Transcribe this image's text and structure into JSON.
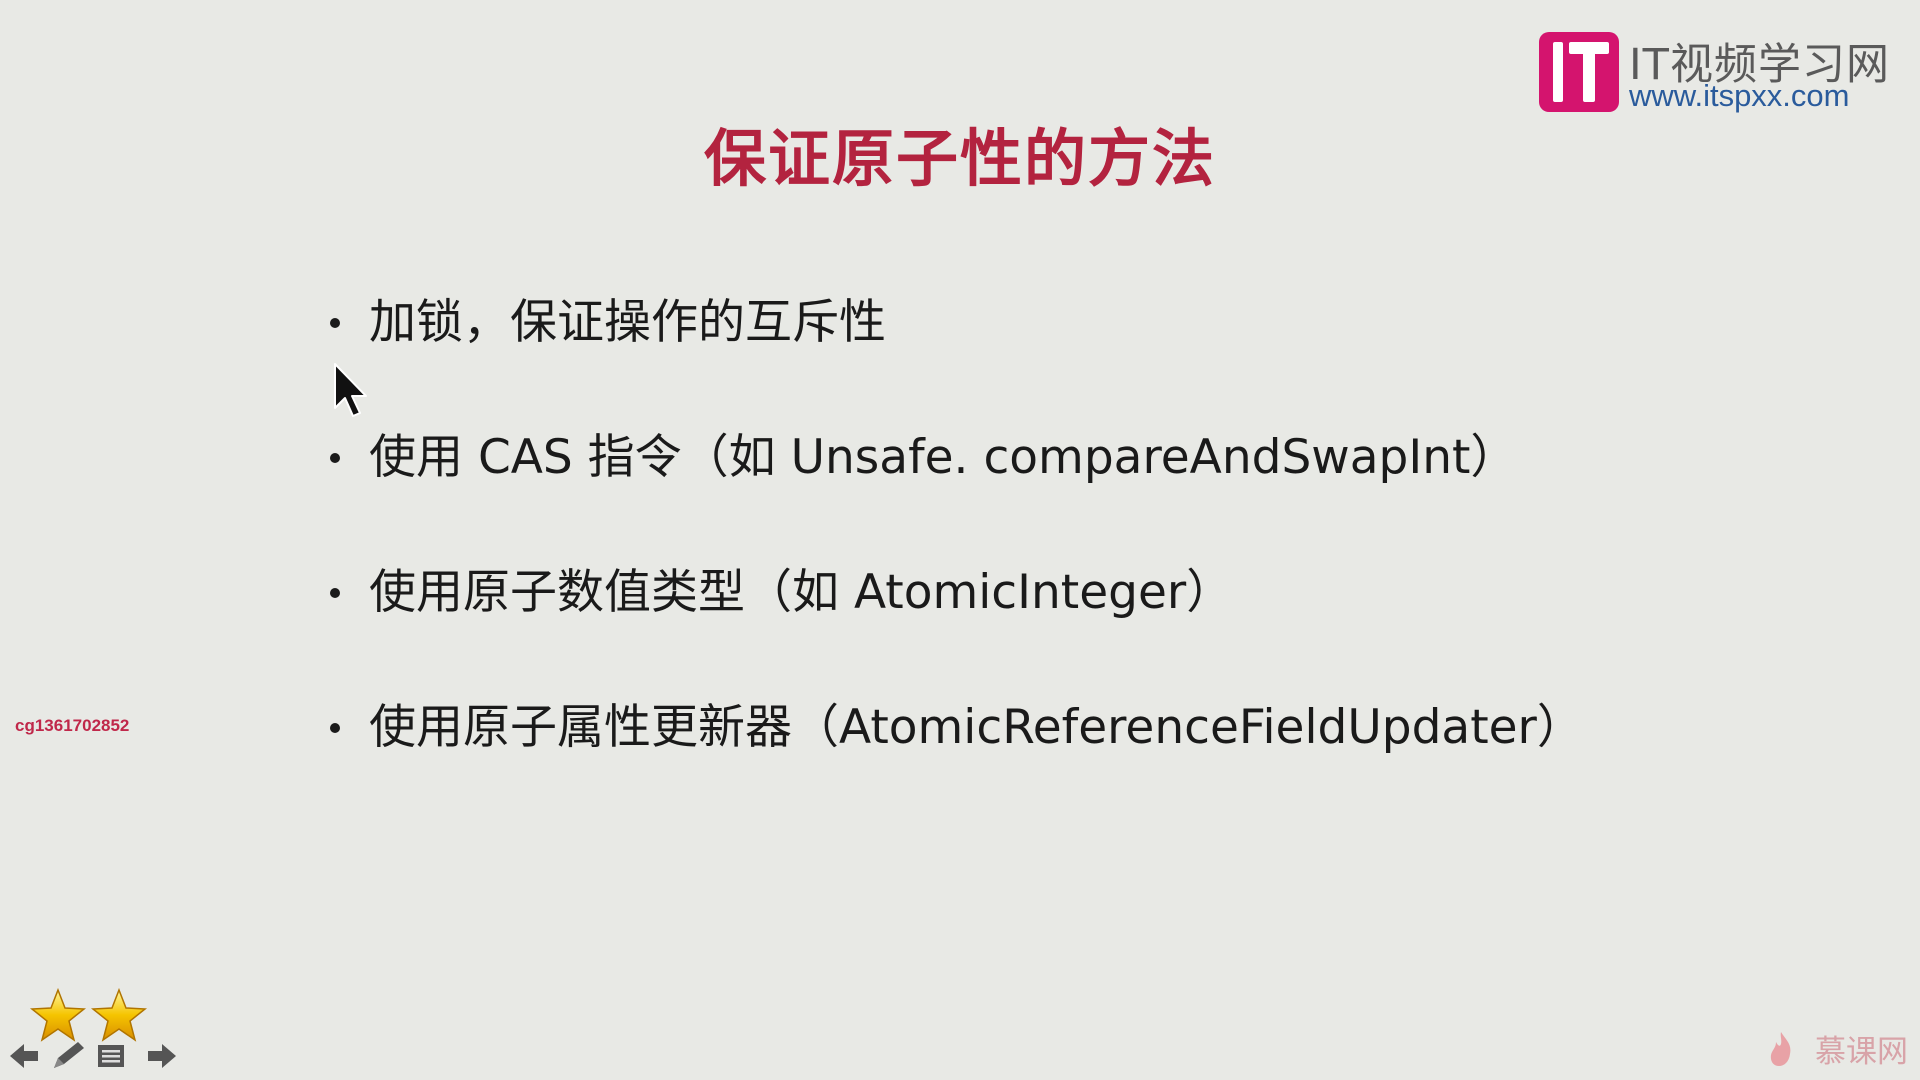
{
  "logo": {
    "title": "IT视频学习网",
    "url": "www.itspxx.com",
    "colors": {
      "mark": "#d4146e",
      "url": "#2a5b9c"
    }
  },
  "slide": {
    "title": "保证原子性的方法",
    "title_color": "#b3233f",
    "bullets": [
      {
        "text": "加锁，保证操作的互斥性"
      },
      {
        "text": "使用 CAS 指令（如 Unsafe. compareAndSwapInt）"
      },
      {
        "text": "使用原子数值类型（如 AtomicInteger）"
      },
      {
        "text": "使用原子属性更新器（AtomicReferenceFieldUpdater）"
      }
    ]
  },
  "watermark": {
    "user_id": "cg1361702852"
  },
  "controls": {
    "icons": [
      "star-icon",
      "star-icon",
      "arrow-left-icon",
      "pen-icon",
      "menu-icon",
      "arrow-right-icon"
    ]
  },
  "brand": {
    "text": "慕课网",
    "color": "#d8a3a8"
  }
}
